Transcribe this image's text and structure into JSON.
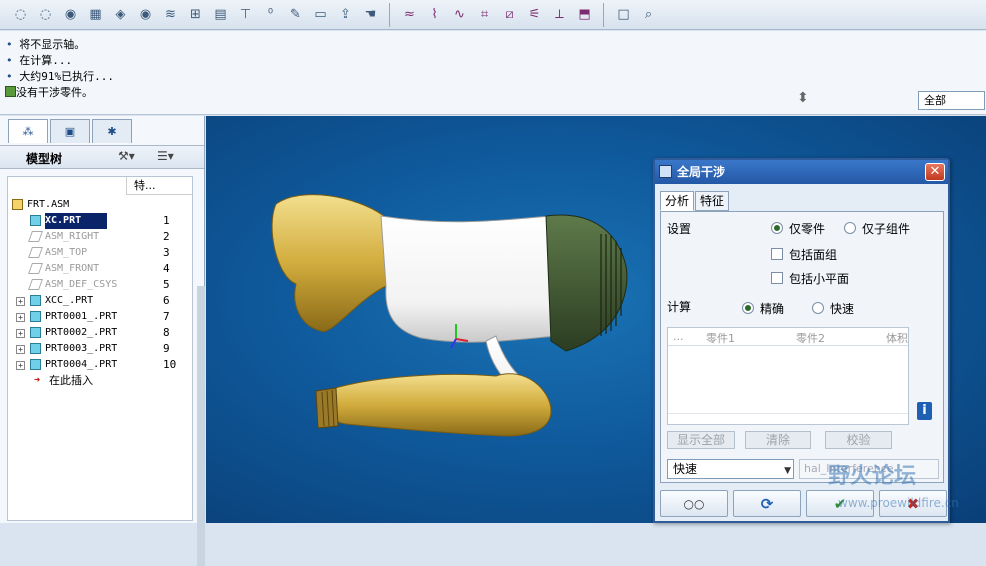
{
  "toolbar": {
    "icons": [
      "eye-hidden-icon",
      "eye-hidden-icon",
      "eye-icon",
      "view-box-icon",
      "shade-icon",
      "eye-icon",
      "layers-icon",
      "graph-icon",
      "table-icon",
      "tree-icon",
      "number-icon",
      "edit-icon",
      "eraser-icon",
      "export-icon",
      "hand-icon",
      "curvature-icon",
      "analysis-icon",
      "shape-icon",
      "mesh-icon",
      "section-icon",
      "draft-icon",
      "datum-icon",
      "cap-icon",
      "window-icon",
      "zoom-icon"
    ]
  },
  "messages": [
    {
      "bullet": "•",
      "text": "将不显示轴。"
    },
    {
      "bullet": "•",
      "text": "在计算..."
    },
    {
      "bullet": "•",
      "text": "大约91%已执行..."
    },
    {
      "bullet": "",
      "text": "没有干涉零件。"
    }
  ],
  "filter": {
    "value": "全部"
  },
  "model_tree": {
    "title": "模型树",
    "column": "特...",
    "rows": [
      {
        "label": "FRT.ASM",
        "num": "",
        "style": "normal",
        "expander": ""
      },
      {
        "label": "XC.PRT",
        "num": "1",
        "style": "selected",
        "expander": ""
      },
      {
        "label": "ASM_RIGHT",
        "num": "2",
        "style": "dim",
        "expander": ""
      },
      {
        "label": "ASM_TOP",
        "num": "3",
        "style": "dim",
        "expander": ""
      },
      {
        "label": "ASM_FRONT",
        "num": "4",
        "style": "dim",
        "expander": ""
      },
      {
        "label": "ASM_DEF_CSYS",
        "num": "5",
        "style": "dim",
        "expander": ""
      },
      {
        "label": "XCC_.PRT",
        "num": "6",
        "style": "normal",
        "expander": "+"
      },
      {
        "label": "PRT0001_.PRT",
        "num": "7",
        "style": "normal",
        "expander": "+"
      },
      {
        "label": "PRT0002_.PRT",
        "num": "8",
        "style": "normal",
        "expander": "+"
      },
      {
        "label": "PRT0003_.PRT",
        "num": "9",
        "style": "normal",
        "expander": "+"
      },
      {
        "label": "PRT0004_.PRT",
        "num": "10",
        "style": "normal",
        "expander": "+"
      },
      {
        "label": "在此插入",
        "num": "",
        "style": "normal",
        "expander": ""
      }
    ]
  },
  "dialog": {
    "title": "全局干涉",
    "close": "✕",
    "tabs": [
      "分析",
      "特征"
    ],
    "settings_label": "设置",
    "opt_parts": "仅零件",
    "opt_subasm": "仅子组件",
    "chk_quilts": "包括面组",
    "chk_facets": "包括小平面",
    "calc_label": "计算",
    "opt_exact": "精确",
    "opt_quick": "快速",
    "list_cols": [
      "...",
      "零件1",
      "零件2",
      "体积"
    ],
    "info": "i",
    "btn_show_all": "显示全部",
    "btn_clear": "清除",
    "btn_check": "校验",
    "combo_value": "快速",
    "combo2_value": "hal_Interference",
    "btn_glasses": "○○",
    "btn_refresh": "⟳",
    "btn_ok": "✔",
    "btn_cancel": "✖"
  },
  "watermark": {
    "title": "野火论坛",
    "url": "www.proewildfire.cn"
  },
  "colors": {
    "viewport": "#0f5a9c",
    "dialog_title": "#2458a6",
    "accent_green": "#2e8b2e",
    "cancel_red": "#c0261a"
  }
}
